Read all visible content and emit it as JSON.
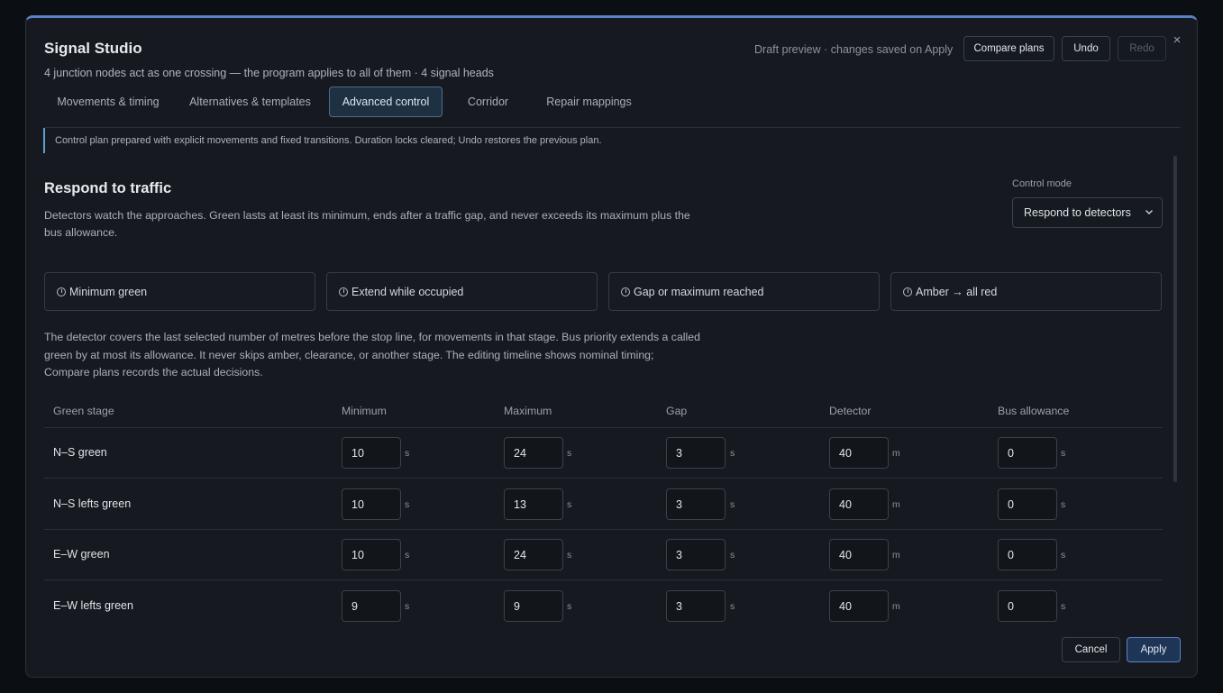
{
  "header": {
    "title": "Signal Studio",
    "subtitle": "4 junction nodes act as one crossing — the program applies to all of them · 4 signal heads",
    "draft_status": "Draft preview · changes saved on Apply",
    "compare_label": "Compare plans",
    "undo_label": "Undo",
    "redo_label": "Redo",
    "close_glyph": "×"
  },
  "tabs": [
    {
      "label": "Movements & timing"
    },
    {
      "label": "Alternatives & templates"
    },
    {
      "label": "Advanced control",
      "active": true
    },
    {
      "label": "Corridor"
    },
    {
      "label": "Repair mappings"
    }
  ],
  "notice": "Control plan prepared with explicit movements and fixed transitions. Duration locks cleared; Undo restores the previous plan.",
  "section": {
    "title": "Respond to traffic",
    "description": "Detectors watch the approaches. Green lasts at least its minimum, ends after a traffic gap, and never exceeds its maximum plus the bus allowance.",
    "mode_label": "Control mode",
    "mode_value": "Respond to detectors"
  },
  "steps": [
    {
      "label": "Minimum green"
    },
    {
      "label": "Extend while occupied"
    },
    {
      "label": "Gap or maximum reached"
    },
    {
      "label": "Amber → all red"
    }
  ],
  "explanation": "The detector covers the last selected number of metres before the stop line, for movements in that stage. Bus priority extends a called green by at most its allowance. It never skips amber, clearance, or another stage. The editing timeline shows nominal timing; Compare plans records the actual decisions.",
  "table": {
    "headers": [
      "Green stage",
      "Minimum",
      "Maximum",
      "Gap",
      "Detector",
      "Bus allowance"
    ],
    "units": [
      "s",
      "s",
      "s",
      "m",
      "s"
    ],
    "rows": [
      {
        "stage": "N–S green",
        "values": [
          "10",
          "24",
          "3",
          "40",
          "0"
        ]
      },
      {
        "stage": "N–S lefts green",
        "values": [
          "10",
          "13",
          "3",
          "40",
          "0"
        ]
      },
      {
        "stage": "E–W green",
        "values": [
          "10",
          "24",
          "3",
          "40",
          "0"
        ]
      },
      {
        "stage": "E–W lefts green",
        "values": [
          "9",
          "9",
          "3",
          "40",
          "0"
        ]
      }
    ]
  },
  "footer": {
    "cancel_label": "Cancel",
    "apply_label": "Apply"
  },
  "colors": {
    "accent": "#5b82c4",
    "notice_bar": "#5b9fd3",
    "active_tab_bg": "#1d3142"
  }
}
